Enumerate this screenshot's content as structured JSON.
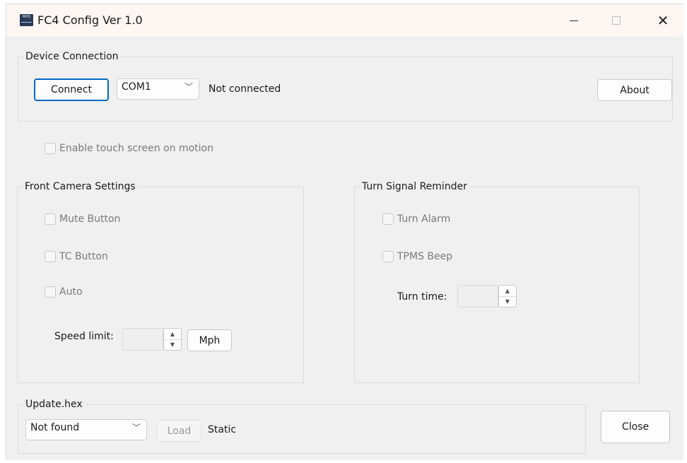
{
  "window": {
    "title": "FC4 Config Ver 1.0",
    "icon_text": "MXS",
    "controls": {
      "minimize": "—",
      "maximize": "□",
      "close": "✕"
    }
  },
  "device_connection": {
    "group_label": "Device Connection",
    "connect_label": "Connect",
    "port_value": "COM1",
    "status": "Not connected",
    "about_label": "About"
  },
  "touch": {
    "label": "Enable touch screen on motion",
    "checked": false
  },
  "front_camera": {
    "group_label": "Front Camera Settings",
    "mute_label": "Mute Button",
    "tc_label": "TC Button",
    "auto_label": "Auto",
    "speed_label": "Speed limit:",
    "speed_value": "",
    "unit_label": "Mph"
  },
  "turn_signal": {
    "group_label": "Turn Signal Reminder",
    "alarm_label": "Turn Alarm",
    "tpms_label": "TPMS Beep",
    "time_label": "Turn time:",
    "time_value": ""
  },
  "update": {
    "group_label": "Update.hex",
    "file_value": "Not found",
    "load_label": "Load",
    "status": "Static"
  },
  "close_label": "Close",
  "icons": {
    "spin_up": "▲",
    "spin_down": "▼",
    "chevron": "﹀"
  }
}
